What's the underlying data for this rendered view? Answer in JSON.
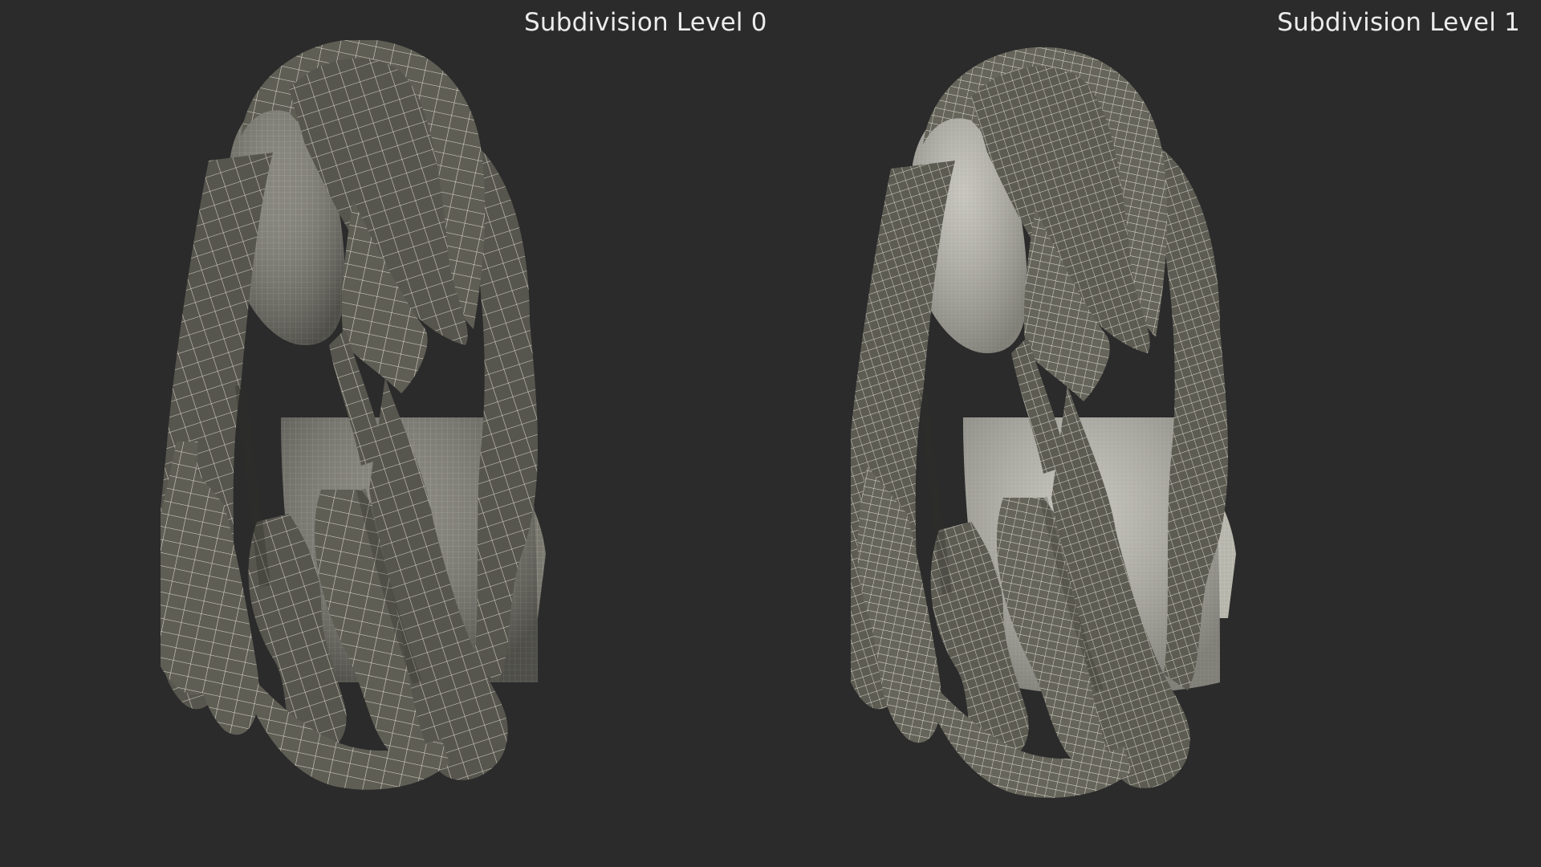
{
  "viewports": [
    {
      "label": "Subdivision Level 0",
      "subdivision_level": 0,
      "mesh_density": "coarse"
    },
    {
      "label": "Subdivision Level 1",
      "subdivision_level": 1,
      "mesh_density": "fine"
    }
  ],
  "colors": {
    "background": "#2b2b2b",
    "label_text": "#ececec",
    "hair_fill": "#5f5e55",
    "hair_shadow": "#46453f",
    "head_fill_level0": "#7d7c73",
    "head_fill_level1": "#b9b8ae",
    "wire_light": "#e6e4d8"
  }
}
